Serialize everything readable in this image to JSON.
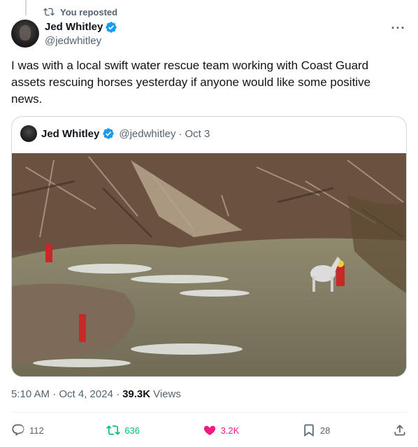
{
  "repost_banner": {
    "label": "You reposted"
  },
  "tweet": {
    "author_name": "Jed Whitley",
    "author_handle": "@jedwhitley",
    "text": "I was with a local swift water rescue team working with Coast Guard assets rescuing horses yesterday if anyone would like some positive news.",
    "more_label": "···"
  },
  "quote": {
    "author_name": "Jed Whitley",
    "author_handle": "@jedwhitley",
    "separator": "·",
    "date": "Oct 3"
  },
  "meta": {
    "timestamp": "5:10 AM · Oct 4, 2024 · ",
    "views_count": "39.3K",
    "views_label": "Views"
  },
  "actions": {
    "replies": "112",
    "reposts": "636",
    "likes": "3.2K",
    "bookmarks": "28"
  },
  "colors": {
    "verified": "#1d9bf0",
    "repost_active": "#00ba7c",
    "like_active": "#f91880",
    "secondary_text": "#536471"
  },
  "icons": {
    "repost_banner": "repost-icon",
    "verified": "verified-badge-icon",
    "more": "more-icon",
    "reply": "reply-icon",
    "repost": "repost-icon",
    "like": "heart-icon",
    "bookmark": "bookmark-icon",
    "share": "share-icon"
  }
}
